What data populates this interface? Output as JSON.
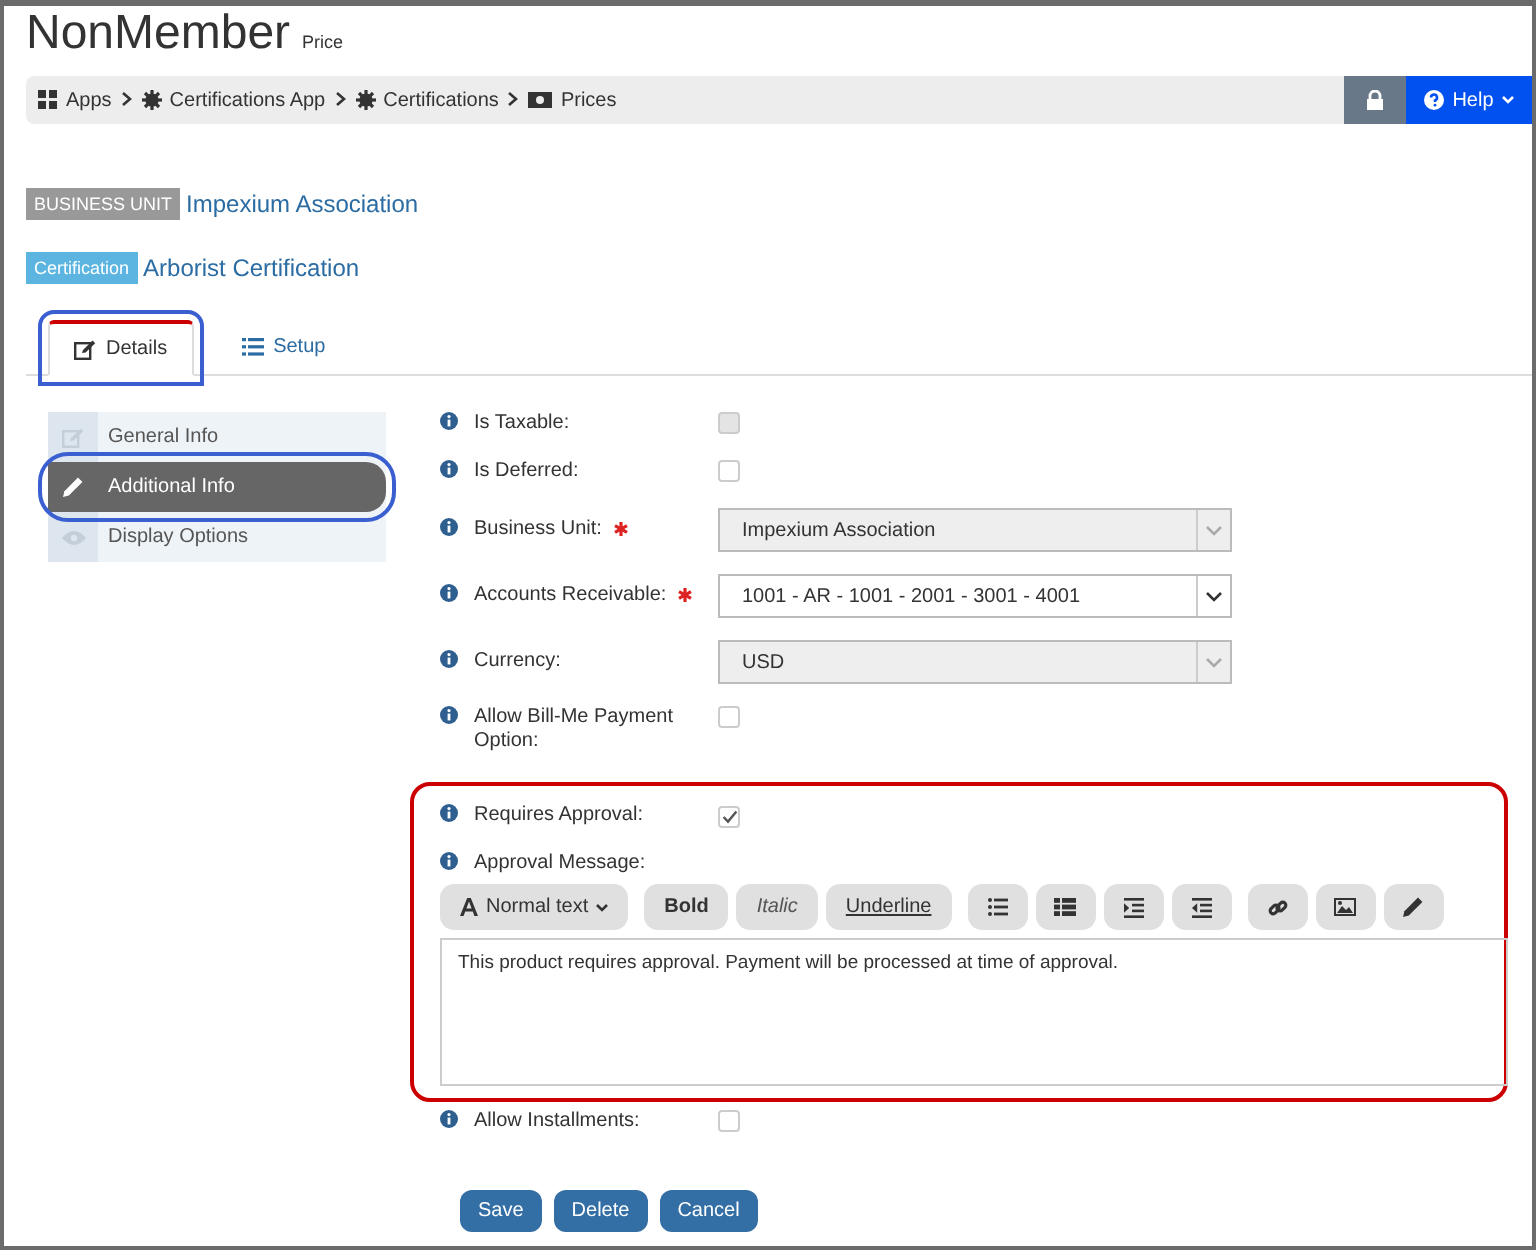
{
  "page": {
    "title": "NonMember",
    "subtitle": "Price"
  },
  "breadcrumb": [
    {
      "label": "Apps",
      "kind": "apps"
    },
    {
      "label": "Certifications App",
      "kind": "app"
    },
    {
      "label": "Certifications",
      "kind": "app"
    },
    {
      "label": "Prices",
      "kind": "prices"
    }
  ],
  "header_buttons": [
    {
      "kind": "lock"
    },
    {
      "kind": "help",
      "label": "Help"
    }
  ],
  "context": [
    {
      "kind": "unit",
      "badge": "BUSINESS UNIT",
      "value": "Impexium Association"
    },
    {
      "kind": "type",
      "badge": "Certification",
      "value": "Arborist Certification"
    }
  ],
  "tabs": [
    {
      "label": "Details",
      "selected": true,
      "annotated": true
    },
    {
      "label": "Setup",
      "selected": false,
      "annotated": false
    }
  ],
  "sidebar": [
    {
      "label": "General Info",
      "selected": false,
      "annotated": false
    },
    {
      "label": "Additional Info",
      "selected": true,
      "annotated": true
    },
    {
      "label": "Display Options",
      "selected": false,
      "annotated": false
    }
  ],
  "fields": [
    {
      "kind": "checkbox",
      "label": "Is Taxable:",
      "checked": false,
      "disabled": true
    },
    {
      "kind": "checkbox",
      "label": "Is Deferred:",
      "checked": false,
      "disabled": false
    },
    {
      "kind": "select",
      "label": "Business Unit:",
      "required": true,
      "value": "Impexium Association",
      "disabled": true
    },
    {
      "kind": "select",
      "label": "Accounts Receivable:",
      "required": true,
      "value": "1001 - AR - 1001 - 2001 - 3001 - 4001",
      "disabled": false
    },
    {
      "kind": "select",
      "label": "Currency:",
      "required": false,
      "value": "USD",
      "disabled": true
    },
    {
      "kind": "checkbox",
      "label": "Allow Bill-Me Payment Option:",
      "checked": false,
      "disabled": false
    }
  ],
  "approval": {
    "annotated": true,
    "requires": {
      "label": "Requires Approval:",
      "checked": true
    },
    "message_label": "Approval Message:",
    "toolbar": [
      {
        "kind": "dropdown",
        "label": "Normal text"
      },
      {
        "kind": "bold",
        "label": "Bold"
      },
      {
        "kind": "italic",
        "label": "Italic"
      },
      {
        "kind": "underline",
        "label": "Underline"
      },
      {
        "kind": "bullets"
      },
      {
        "kind": "list"
      },
      {
        "kind": "indent"
      },
      {
        "kind": "outdent"
      },
      {
        "kind": "link"
      },
      {
        "kind": "image"
      },
      {
        "kind": "pencil"
      }
    ],
    "message": "This product requires approval. Payment will be processed at time of approval."
  },
  "fields_after": [
    {
      "kind": "checkbox",
      "label": "Allow Installments:",
      "checked": false,
      "disabled": false
    }
  ],
  "buttons": [
    "Save",
    "Delete",
    "Cancel"
  ]
}
